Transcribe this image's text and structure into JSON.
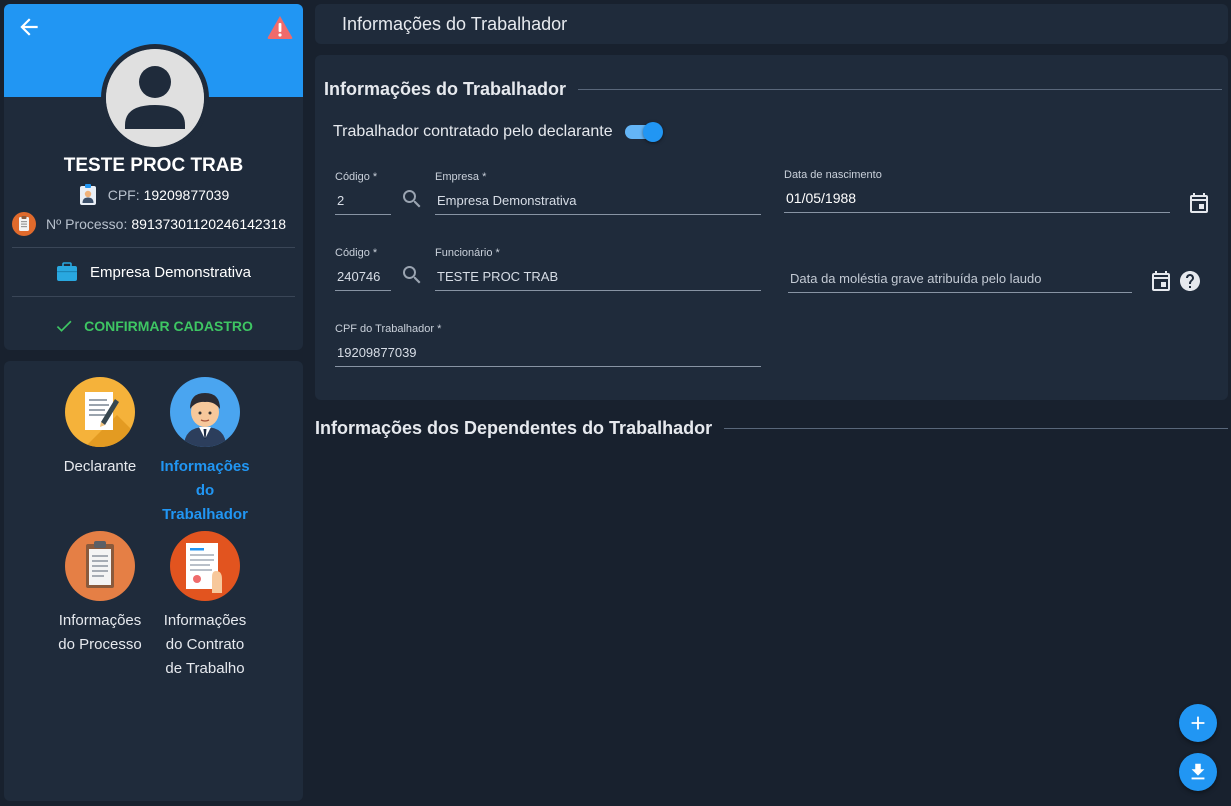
{
  "profile": {
    "name": "TESTE PROC TRAB",
    "cpf_label": "CPF:",
    "cpf_value": "19209877039",
    "process_label": "Nº Processo:",
    "process_value": "89137301120246142318",
    "company": "Empresa Demonstrativa",
    "confirm_label": "CONFIRMAR CADASTRO"
  },
  "nav": {
    "items": [
      {
        "label": "Declarante",
        "active": false
      },
      {
        "label": "Informações do Trabalhador",
        "line1": "Informações",
        "line2": "do",
        "line3": "Trabalhador",
        "active": true
      },
      {
        "label": "Informações do Processo",
        "line1": "Informações",
        "line2": "do Processo",
        "active": false
      },
      {
        "label": "Informações do Contrato de Trabalho",
        "line1": "Informações",
        "line2": "do Contrato",
        "line3": "de Trabalho",
        "active": false
      }
    ]
  },
  "header": {
    "title": "Informações do Trabalhador"
  },
  "worker": {
    "section_title": "Informações do Trabalhador",
    "hired_label": "Trabalhador contratado pelo declarante",
    "hired_value": true,
    "company_code_label": "Código *",
    "company_code_value": "2",
    "company_label": "Empresa *",
    "company_value": "Empresa Demonstrativa",
    "birth_label": "Data de nascimento",
    "birth_value": "01/05/1988",
    "employee_code_label": "Código *",
    "employee_code_value": "240746",
    "employee_label": "Funcionário *",
    "employee_value": "TESTE PROC TRAB",
    "illness_placeholder": "Data da moléstia grave atribuída pelo laudo",
    "cpf_label": "CPF do Trabalhador *",
    "cpf_value": "19209877039"
  },
  "dependents": {
    "section_title": "Informações dos Dependentes do Trabalhador"
  },
  "colors": {
    "accent": "#2196f3",
    "success": "#3ec663",
    "background": "#18212e",
    "card": "#1f2b3b",
    "alert": "#ef6b6b"
  },
  "icons": [
    "arrow-left-icon",
    "alert-icon",
    "person-icon",
    "id-badge-icon",
    "clipboard-icon",
    "briefcase-icon",
    "check-icon",
    "search-icon",
    "calendar-icon",
    "help-icon",
    "plus-icon",
    "download-icon"
  ]
}
